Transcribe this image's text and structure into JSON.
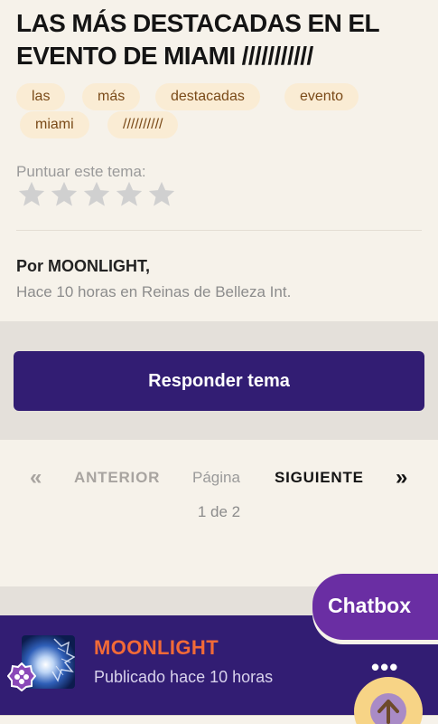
{
  "topic": {
    "title": "LAS MÁS DESTACADAS EN EL EVENTO DE MIAMI ///////////",
    "tags": [
      "las",
      "más",
      "destacadas",
      "evento",
      "miami",
      "//////////"
    ],
    "rating_label": "Puntuar este tema:",
    "rating_stars_filled": 0,
    "rating_stars_total": 5,
    "author": "Por MOONLIGHT,",
    "meta": "Hace 10 horas en Reinas de Belleza Int."
  },
  "actions": {
    "reply_label": "Responder tema"
  },
  "pagination": {
    "first_glyph": "«",
    "prev_label": "ANTERIOR",
    "page_label": "Página",
    "next_label": "SIGUIENTE",
    "last_glyph": "»",
    "count": "1 de 2"
  },
  "post": {
    "author_name": "MOONLIGHT",
    "published": "Publicado hace 10 horas",
    "more_glyph": "•••"
  },
  "chatbox": {
    "label": "Chatbox"
  },
  "icons": {
    "star": "star-icon",
    "badge": "flower-badge-icon",
    "scroll_top": "arrow-up-icon"
  },
  "colors": {
    "accent": "#321d73",
    "chatbox": "#6a2ea3",
    "author_orange": "#f26a37",
    "tag_bg": "#faecd4",
    "tag_text": "#7a4a18",
    "star": "#d0d0d0"
  }
}
